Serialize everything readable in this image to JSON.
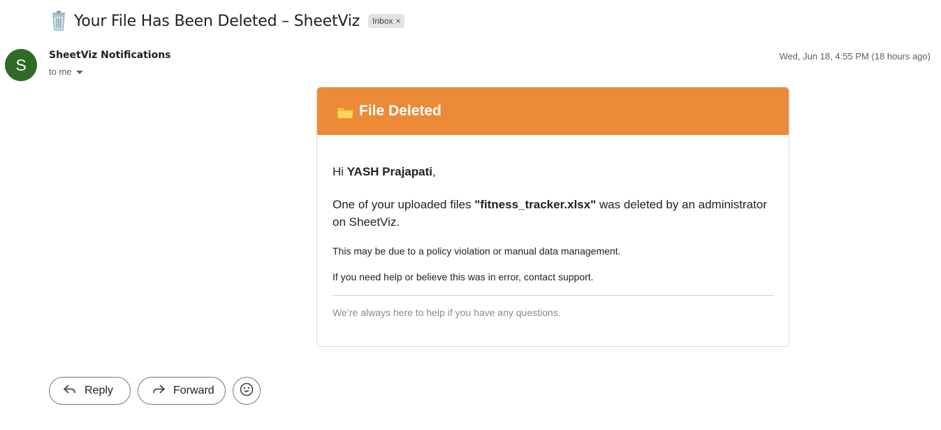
{
  "email": {
    "subject": "Your File Has Been Deleted – SheetViz",
    "subject_icon": "trash-can-icon",
    "label": "Inbox",
    "label_close": "×",
    "sender_initial": "S",
    "sender_name": "SheetViz Notifications",
    "recipient": "to me",
    "timestamp": "Wed, Jun 18, 4:55 PM (18 hours ago)"
  },
  "message": {
    "header_icon": "folder-icon",
    "header_title": "File Deleted",
    "header_color": "#ed8a37",
    "greeting_prefix": "Hi ",
    "greeting_name": "YASH Prajapati",
    "greeting_suffix": ",",
    "body_prefix": "One of your uploaded files ",
    "file_name": "\"fitness_tracker.xlsx\"",
    "body_suffix": " was deleted by an administrator on SheetViz.",
    "reason": "This may be due to a policy violation or manual data management.",
    "help": "If you need help or believe this was in error, contact support.",
    "footer": "We’re always here to help if you have any questions."
  },
  "actions": {
    "reply_label": "Reply",
    "forward_label": "Forward",
    "emoji_icon": "smiley-icon"
  }
}
